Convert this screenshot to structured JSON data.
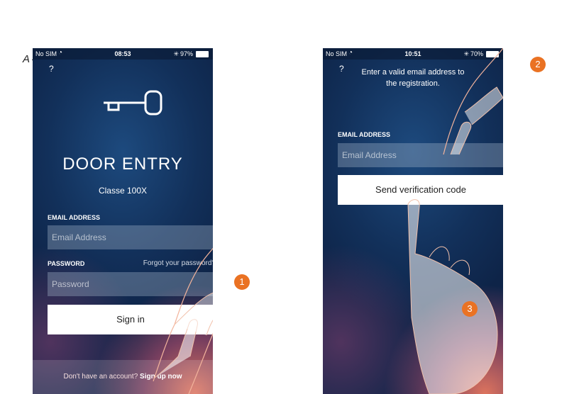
{
  "callout": {
    "label": "A"
  },
  "left_screen": {
    "status": {
      "carrier": "No SIM",
      "time": "08:53",
      "battery": "97%"
    },
    "help": "?",
    "title": "DOOR ENTRY",
    "subtitle": "Classe 100X",
    "email_label": "EMAIL ADDRESS",
    "email_placeholder": "Email Address",
    "password_label": "PASSWORD",
    "forgot": "Forgot your password?",
    "password_placeholder": "Password",
    "sign_in": "Sign in",
    "signup_prompt": "Don't have an account?",
    "signup_link": "Sign up now"
  },
  "right_screen": {
    "status": {
      "carrier": "No SIM",
      "time": "10:51",
      "battery": "70%"
    },
    "help": "?",
    "instruction_line1": "Enter a valid email address to",
    "instruction_line2": "the registration.",
    "email_label": "EMAIL ADDRESS",
    "email_placeholder": "Email Address",
    "send_button": "Send verification code"
  },
  "step_badges": [
    "1",
    "2",
    "3"
  ],
  "colors": {
    "badge": "#ea7223",
    "background_top": "#12305a",
    "background_glow": "#e8785f"
  }
}
